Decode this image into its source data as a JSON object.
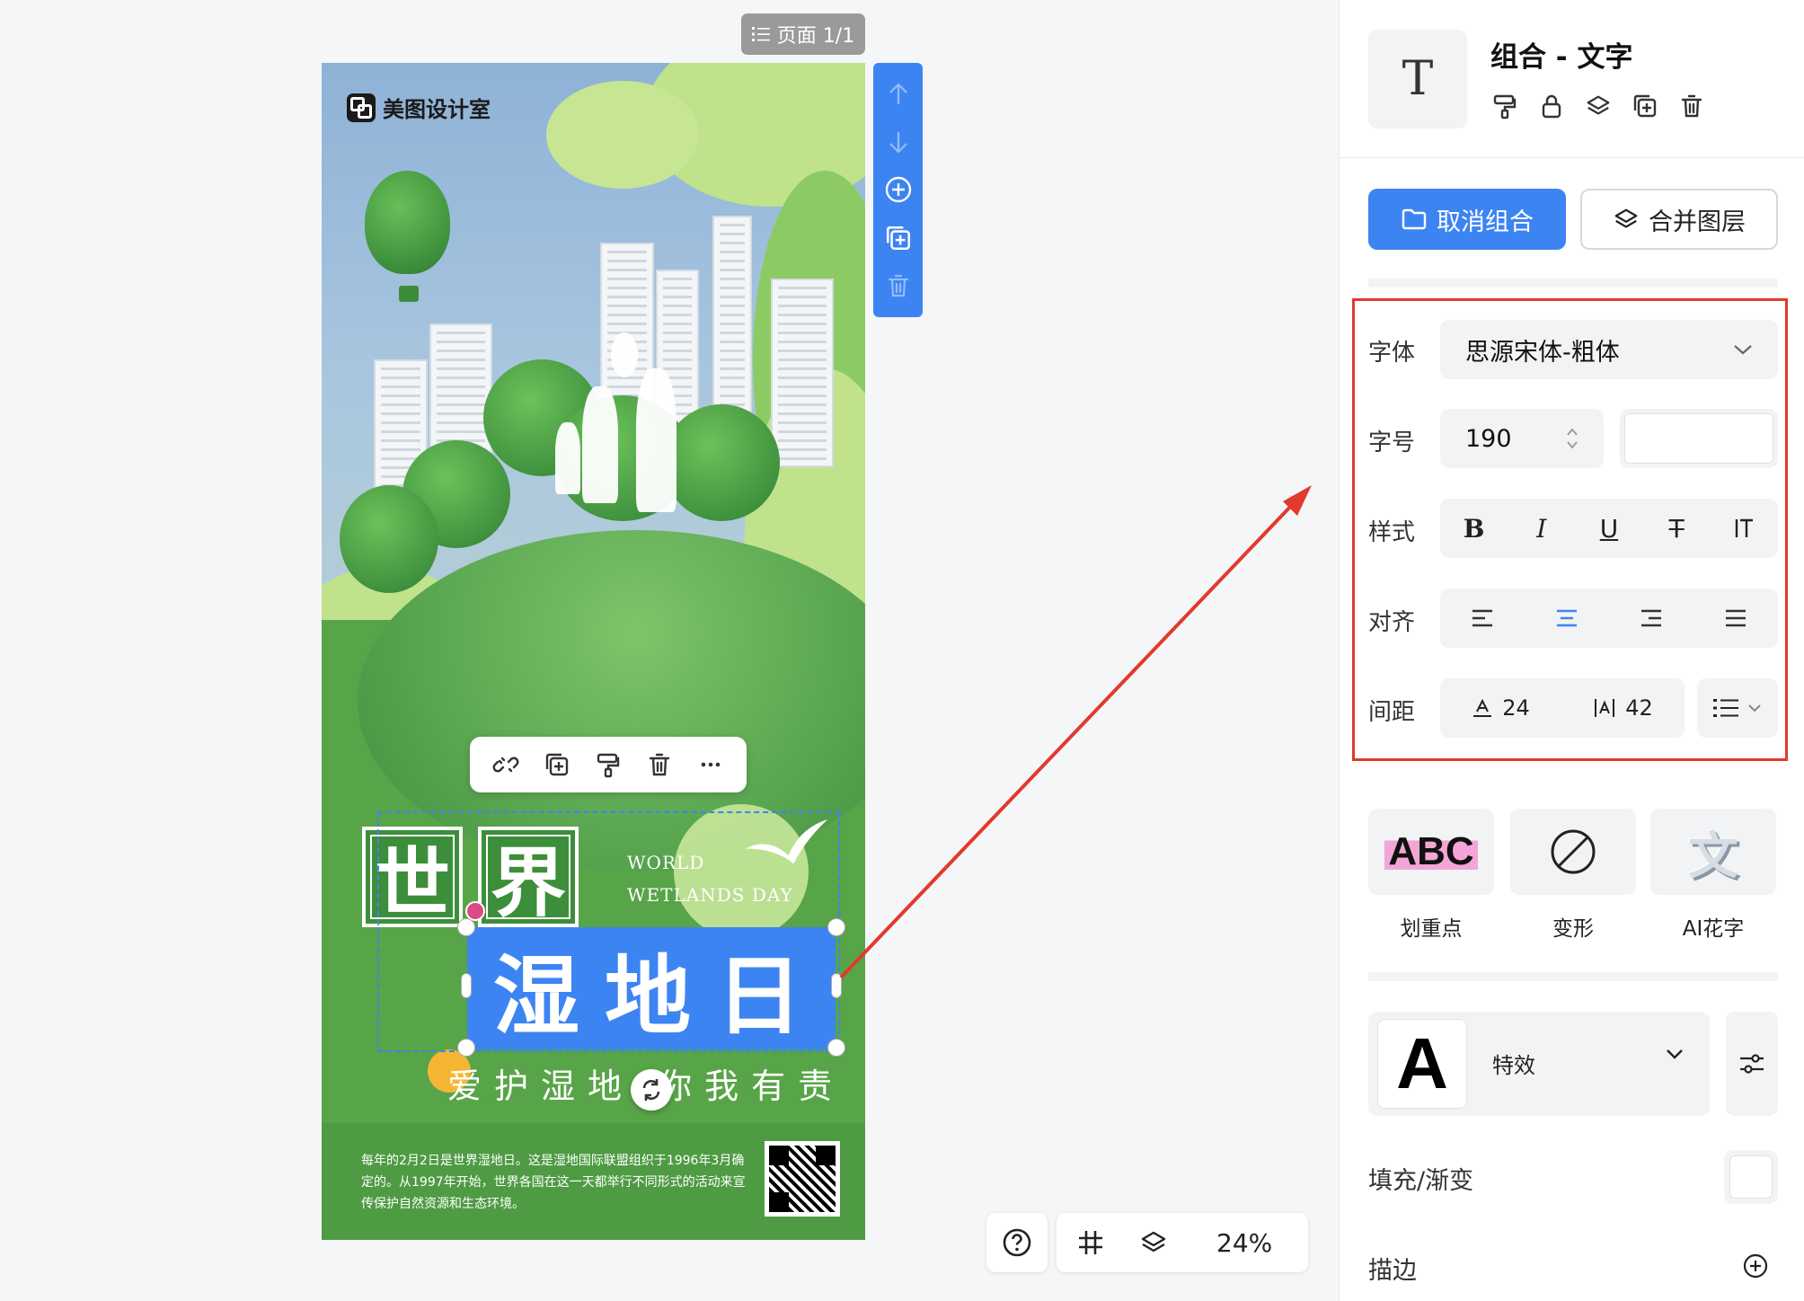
{
  "canvas": {
    "page_indicator": "页面 1/1",
    "zoom_level": "24%"
  },
  "poster": {
    "brand": "美图设计室",
    "title_char_1": "世",
    "title_char_2": "界",
    "title_en_line1": "WORLD",
    "title_en_line2": "WETLANDS DAY",
    "selected_text": "湿地日",
    "subtitle": "爱护湿地 你我有责",
    "description": "每年的2月2日是世界湿地日。这是湿地国际联盟组织于1996年3月确定的。从1997年开始，世界各国在这一天都举行不同形式的活动来宣传保护自然资源和生态环境。"
  },
  "panel": {
    "title": "组合 - 文字",
    "type_icon": "T",
    "ungroup_label": "取消组合",
    "merge_label": "合并图层",
    "font_label": "字体",
    "font_value": "思源宋体-粗体",
    "size_label": "字号",
    "size_value": "190",
    "style_label": "样式",
    "style_buttons": {
      "bold": "B",
      "italic": "I",
      "underline": "U",
      "strike": "T"
    },
    "align_label": "对齐",
    "spacing_label": "间距",
    "letter_spacing": "24",
    "line_spacing": "42",
    "effect_1_preview": "ABC",
    "effect_1_label": "划重点",
    "effect_2_label": "变形",
    "effect_3_preview": "文",
    "effect_3_label": "AI花字",
    "effects_preview": "A",
    "effects_label": "特效",
    "fill_label": "填充/渐变",
    "stroke_label": "描边"
  },
  "colors": {
    "accent": "#3d84f3",
    "annotation": "#e23a2d",
    "panel_field": "#f2f3f5"
  }
}
